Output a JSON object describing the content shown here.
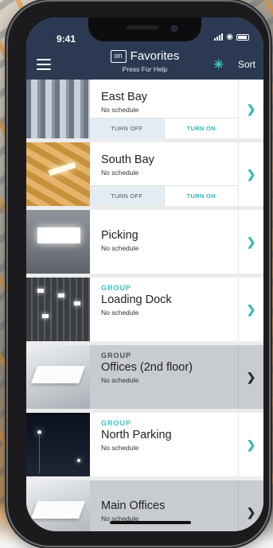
{
  "status": {
    "time": "9:41"
  },
  "header": {
    "logo_text": "on",
    "title": "Favorites",
    "subtitle": "Press For Help",
    "sort_label": "Sort",
    "bluetooth_symbol": "✳",
    "accent_color": "#3ec9c2",
    "bar_color": "#2b3a52"
  },
  "toggle_labels": {
    "off": "TURN OFF",
    "on": "TURN ON"
  },
  "items": [
    {
      "name": "East Bay",
      "schedule": "No schedule",
      "group_label": "",
      "image": "warehouse-racks-image",
      "toggles": true,
      "highlighted": false
    },
    {
      "name": "South Bay",
      "schedule": "No schedule",
      "group_label": "",
      "image": "warehouse-ceiling-image",
      "toggles": true,
      "highlighted": false
    },
    {
      "name": "Picking",
      "schedule": "No schedule",
      "group_label": "",
      "image": "ceiling-light-panel-image",
      "toggles": false,
      "highlighted": false
    },
    {
      "name": "Loading Dock",
      "schedule": "No schedule",
      "group_label": "GROUP",
      "image": "dock-ceiling-lights-image",
      "toggles": false,
      "highlighted": false
    },
    {
      "name": "Offices (2nd floor)",
      "schedule": "No schedule",
      "group_label": "GROUP",
      "image": "office-troffer-image",
      "toggles": false,
      "highlighted": true
    },
    {
      "name": "North Parking",
      "schedule": "No schedule",
      "group_label": "GROUP",
      "image": "night-parking-lamps-image",
      "toggles": false,
      "highlighted": false
    },
    {
      "name": "Main Offices",
      "schedule": "No schedule",
      "group_label": "",
      "image": "office-troffer-image",
      "toggles": false,
      "highlighted": true
    }
  ]
}
